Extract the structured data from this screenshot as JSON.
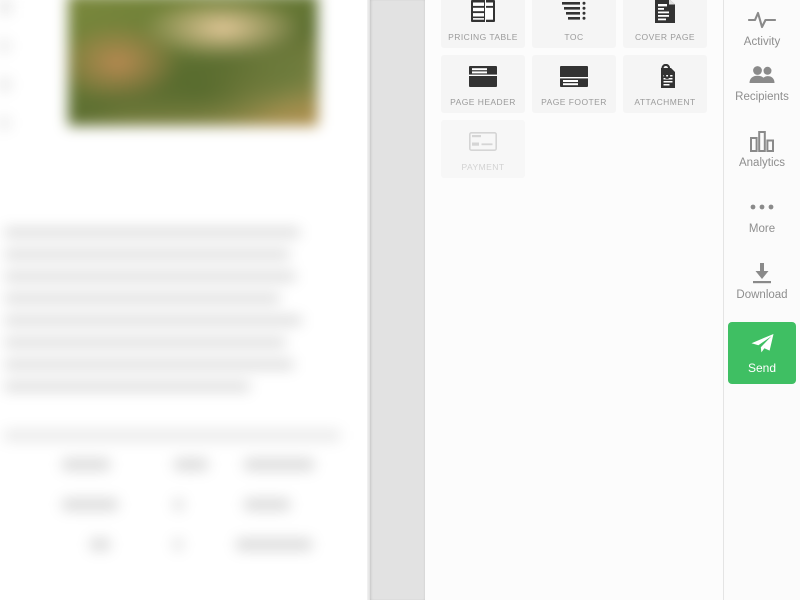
{
  "document_preview": {
    "name": "document-preview",
    "state": "blurred-preview",
    "hero_image": {
      "name": "hero-photo",
      "description": "landscape photo with green and tan tones"
    },
    "body_line_count": 8,
    "table": {
      "column_count": 3,
      "row_count": 2
    }
  },
  "blocks_panel": {
    "tiles": [
      {
        "label": "PRICING TABLE",
        "icon": "pricing-table-icon",
        "disabled": false
      },
      {
        "label": "TOC",
        "icon": "toc-icon",
        "disabled": false
      },
      {
        "label": "COVER PAGE",
        "icon": "cover-page-icon",
        "disabled": false
      },
      {
        "label": "PAGE HEADER",
        "icon": "page-header-icon",
        "disabled": false
      },
      {
        "label": "PAGE FOOTER",
        "icon": "page-footer-icon",
        "disabled": false
      },
      {
        "label": "ATTACHMENT",
        "icon": "attachment-icon",
        "disabled": false
      },
      {
        "label": "PAYMENT",
        "icon": "payment-card-icon",
        "disabled": true
      }
    ]
  },
  "right_rail": {
    "items": [
      {
        "label": "Activity",
        "icon": "activity-pulse-icon"
      },
      {
        "label": "Recipients",
        "icon": "recipients-people-icon"
      },
      {
        "label": "Analytics",
        "icon": "analytics-bars-icon"
      },
      {
        "label": "More",
        "icon": "more-dots-icon"
      },
      {
        "label": "Download",
        "icon": "download-arrow-icon"
      }
    ],
    "send_button": {
      "label": "Send",
      "icon": "send-paper-plane-icon",
      "color": "#3fbf63"
    }
  },
  "colors": {
    "accent_green": "#3fbf63",
    "tile_bg": "#f5f5f5",
    "tile_label": "#9a9a9a",
    "tile_label_disabled": "#d2d2d2",
    "rail_label": "#8e8e8e",
    "icon_dark": "#333333",
    "icon_light": "#d5d5d5",
    "gutter": "#e2e2e2"
  }
}
